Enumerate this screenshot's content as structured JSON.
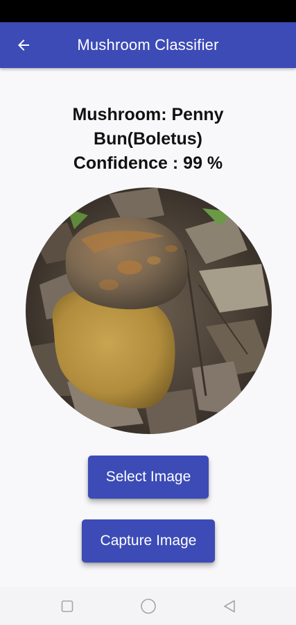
{
  "app_bar": {
    "title": "Mushroom Classifier",
    "back_icon": "arrow-left-icon"
  },
  "result": {
    "line1": "Mushroom: Penny",
    "line2": "Bun(Boletus)",
    "line3": "Confidence : 99 %"
  },
  "buttons": {
    "select_label": "Select Image",
    "capture_label": "Capture Image"
  },
  "nav_bar": {
    "icons": [
      "recent-apps-icon",
      "home-icon",
      "back-triangle-icon"
    ]
  },
  "colors": {
    "primary": "#3c4bb6",
    "background": "#f8f8fa",
    "status_bar": "#000000"
  }
}
